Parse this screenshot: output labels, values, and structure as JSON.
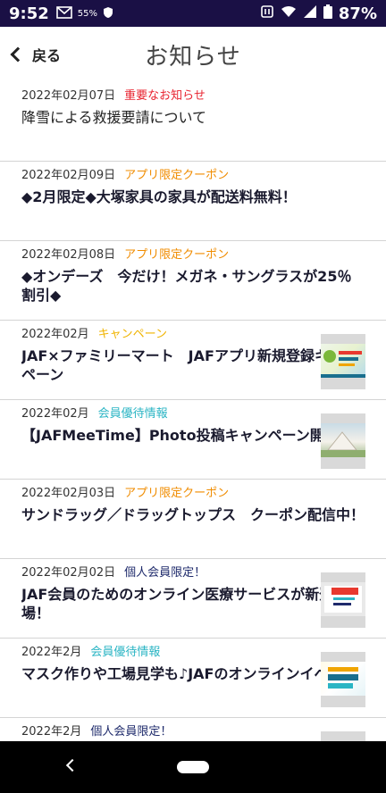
{
  "status_bar": {
    "time": "9:52",
    "small_text": "55%",
    "battery": "87%"
  },
  "header": {
    "back_label": "戻る",
    "title": "お知らせ"
  },
  "news": [
    {
      "date": "2022年02月07日",
      "category": "重要なお知らせ",
      "category_color": "#e8232f",
      "title": "降雪による救援要請について",
      "bold": false,
      "thumb": null
    },
    {
      "date": "2022年02月09日",
      "category": "アプリ限定クーポン",
      "category_color": "#f08c00",
      "title": "◆2月限定◆大塚家具の家具が配送料無料！",
      "bold": true,
      "thumb": null
    },
    {
      "date": "2022年02月08日",
      "category": "アプリ限定クーポン",
      "category_color": "#f08c00",
      "title": "◆オンデーズ　今だけ！メガネ・サングラスが25％割引◆",
      "bold": true,
      "thumb": null
    },
    {
      "date": "2022年02月",
      "category": "キャンペーン",
      "category_color": "#f0b400",
      "title": "JAF×ファミリーマート　JAFアプリ新規登録キャンペーン",
      "bold": true,
      "thumb": "t1"
    },
    {
      "date": "2022年02月",
      "category": "会員優待情報",
      "category_color": "#2bb5c4",
      "title": "【JAFMeeTime】Photo投稿キャンペーン開催中",
      "bold": true,
      "thumb": "t2"
    },
    {
      "date": "2022年02月03日",
      "category": "アプリ限定クーポン",
      "category_color": "#f08c00",
      "title": "サンドラッグ／ドラッグトップス　クーポン配信中！",
      "bold": true,
      "thumb": null
    },
    {
      "date": "2022年02月02日",
      "category": "個人会員限定！",
      "category_color": "#1e2a6b",
      "title": "JAF会員のためのオンライン医療サービスが新登場！",
      "bold": true,
      "thumb": "t3"
    },
    {
      "date": "2022年2月",
      "category": "会員優待情報",
      "category_color": "#2bb5c4",
      "title": "マスク作りや工場見学も♪JAFのオンラインイベント",
      "bold": true,
      "thumb": "t4"
    },
    {
      "date": "2022年2月",
      "category": "個人会員限定！",
      "category_color": "#1e2a6b",
      "title": "",
      "bold": true,
      "thumb": "t3"
    }
  ]
}
